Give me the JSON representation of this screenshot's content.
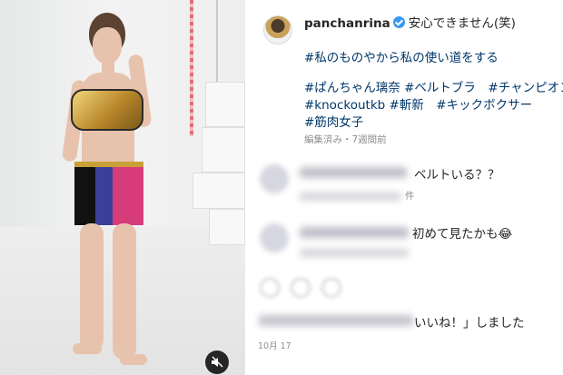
{
  "post": {
    "username": "panchanrina",
    "caption_text": "安心できません(笑)",
    "caption_line2": "#私のものやから私の使い道をする",
    "hashtags_line1": "#ぱんちゃん璃奈 #ベルトブラ　#チャンピオン",
    "hashtags_line2": "#knockoutkb #斬新　#キックボクサー",
    "hashtags_line3": "#筋肉女子",
    "meta": "編集済み・7週間前"
  },
  "comments": [
    {
      "text_visible": "ベルトいる？？",
      "meta_visible": "件"
    },
    {
      "text_visible": "初めて見たかも😂"
    }
  ],
  "likes_line_visible": "いいね！」しました",
  "date": "10月 17",
  "icons": {
    "mute": "muted-speaker-icon",
    "verified": "verified-badge-icon",
    "avatar": "profile-avatar"
  },
  "colors": {
    "verified": "#3897f0",
    "hashtag": "#00376b",
    "meta": "#8e8e8e",
    "text": "#262626"
  }
}
